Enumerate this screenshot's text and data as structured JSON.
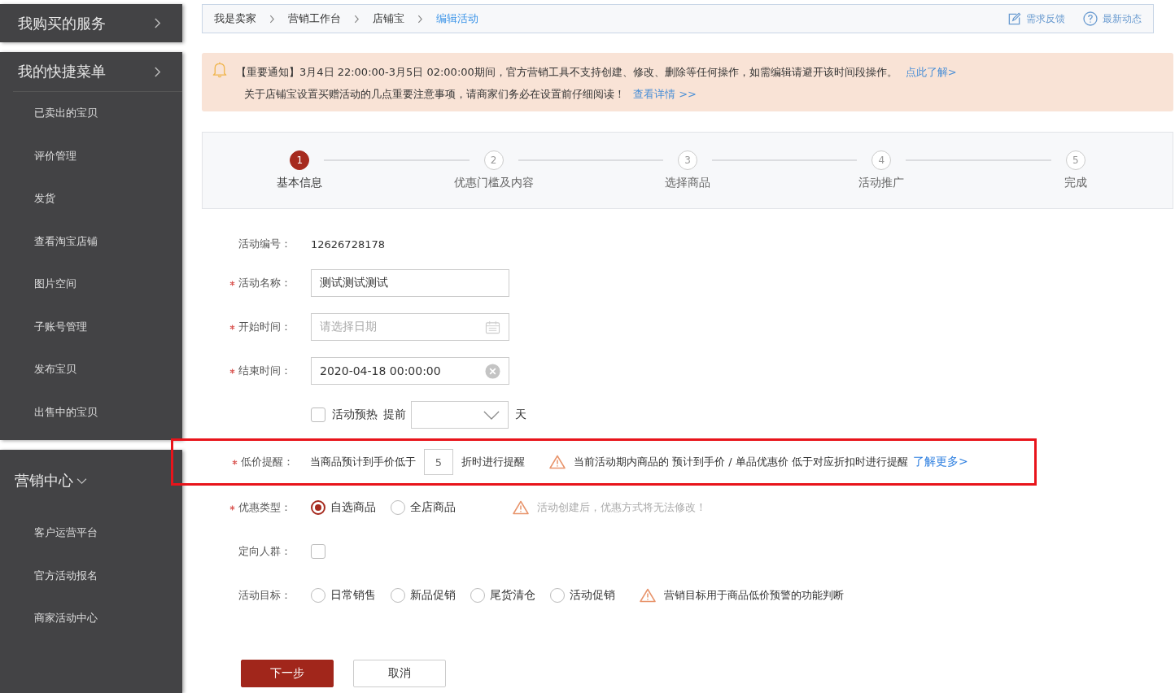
{
  "sidebar": {
    "sections": [
      {
        "title": "我购买的服务",
        "kind": "link"
      },
      {
        "title": "我的快捷菜单",
        "kind": "link",
        "items": [
          "已卖出的宝贝",
          "评价管理",
          "发货",
          "查看淘宝店铺",
          "图片空间",
          "子账号管理",
          "发布宝贝",
          "出售中的宝贝"
        ]
      },
      {
        "title": "营销中心",
        "kind": "expandable",
        "expanded": true,
        "items": [
          "客户运营平台",
          "官方活动报名",
          "商家活动中心"
        ]
      }
    ]
  },
  "breadcrumb": {
    "items": [
      {
        "label": "我是卖家",
        "selected": false
      },
      {
        "label": "营销工作台",
        "selected": false
      },
      {
        "label": "店铺宝",
        "selected": false
      },
      {
        "label": "编辑活动",
        "selected": true
      }
    ],
    "actions": [
      {
        "label": "需求反馈",
        "kind": "feedback"
      },
      {
        "label": "最新动态",
        "kind": "help"
      }
    ]
  },
  "notice": {
    "lines": [
      {
        "text": "【重要通知】3月4日 22:00:00-3月5日 02:00:00期间，官方营销工具不支持创建、修改、删除等任何操作，如需编辑请避开该时间段操作。",
        "link": "点此了解>"
      },
      {
        "text": "关于店铺宝设置买赠活动的几点重要注意事项，请商家们务必在设置前仔细阅读！",
        "link": "查看详情 >>"
      }
    ]
  },
  "steps": [
    {
      "number": "1",
      "label": "基本信息",
      "selected": true
    },
    {
      "number": "2",
      "label": "优惠门槛及内容",
      "selected": false
    },
    {
      "number": "3",
      "label": "选择商品",
      "selected": false
    },
    {
      "number": "4",
      "label": "活动推广",
      "selected": false
    },
    {
      "number": "5",
      "label": "完成",
      "selected": false
    }
  ],
  "form": [
    {
      "kind": "text",
      "label": "活动编号：",
      "required": false,
      "value": "12626728178"
    },
    {
      "kind": "input",
      "label": "活动名称：",
      "required": true,
      "value": "测试测试测试"
    },
    {
      "kind": "date",
      "label": "开始时间：",
      "required": true,
      "placeholder": "请选择日期"
    },
    {
      "kind": "date",
      "label": "结束时间：",
      "required": true,
      "value": "2020-04-18 00:00:00"
    },
    {
      "kind": "preheat",
      "checkbox": {
        "label": "活动预热",
        "checked": false
      },
      "prefix": "提前",
      "suffix": "天"
    },
    {
      "kind": "threshold",
      "label": "低价提醒：",
      "required": true,
      "highlighted": true,
      "before": "当商品预计到手价低于",
      "value": "5",
      "after": "折时进行提醒",
      "warning": "当前活动期内商品的 预计到手价 / 单品优惠价 低于对应折扣时进行提醒",
      "link": "了解更多>"
    },
    {
      "kind": "radio",
      "label": "优惠类型：",
      "required": true,
      "options": [
        {
          "label": "自选商品",
          "selected": true
        },
        {
          "label": "全店商品",
          "selected": false
        }
      ],
      "warning": "活动创建后，优惠方式将无法修改！",
      "warning_muted": true
    },
    {
      "kind": "checkbox",
      "label": "定向人群：",
      "required": false,
      "checked": false
    },
    {
      "kind": "radio",
      "label": "活动目标：",
      "required": false,
      "options": [
        {
          "label": "日常销售",
          "selected": false
        },
        {
          "label": "新品促销",
          "selected": false
        },
        {
          "label": "尾货清仓",
          "selected": false
        },
        {
          "label": "活动促销",
          "selected": false
        }
      ],
      "warning": "营销目标用于商品低价预警的功能判断",
      "warning_muted": false
    }
  ],
  "buttons": [
    {
      "label": "下一步",
      "kind": "primary"
    },
    {
      "label": "取消",
      "kind": "default"
    }
  ]
}
